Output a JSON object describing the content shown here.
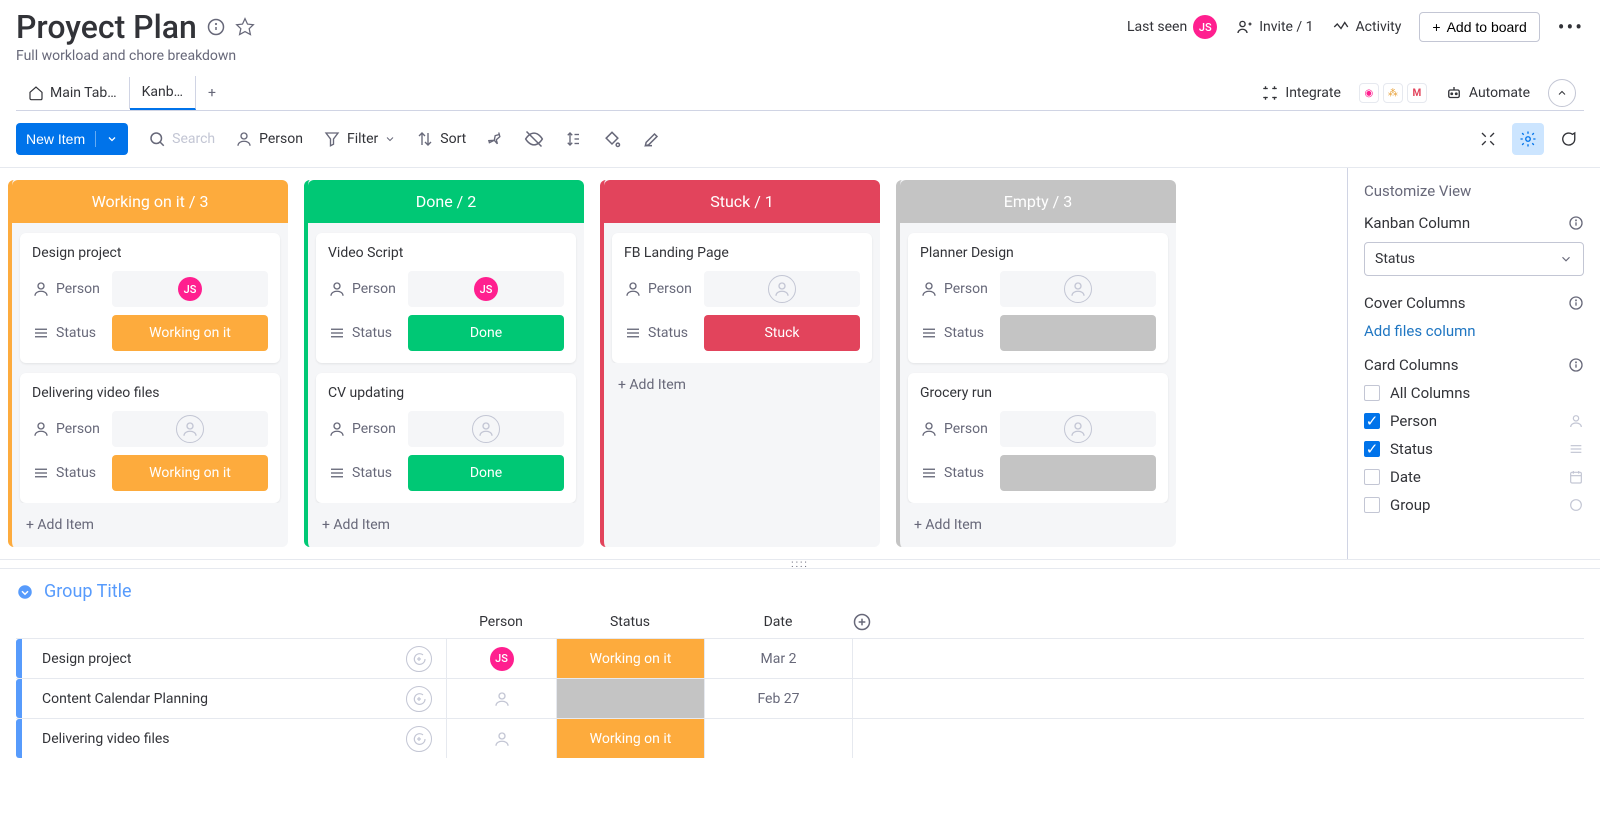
{
  "header": {
    "title": "Proyect Plan",
    "subtitle": "Full workload and chore breakdown",
    "last_seen": "Last seen",
    "avatar": "JS",
    "invite": "Invite / 1",
    "activity": "Activity",
    "add_to_board": "Add to board"
  },
  "tabs": {
    "main": "Main Tab…",
    "kanban": "Kanb…",
    "integrate": "Integrate",
    "automate": "Automate"
  },
  "toolbar": {
    "new_item": "New Item",
    "search": "Search",
    "person": "Person",
    "filter": "Filter",
    "sort": "Sort"
  },
  "columns": [
    {
      "title": "Working on it / 3",
      "color": "orange",
      "add": "+ Add Item",
      "cards": [
        {
          "title": "Design project",
          "person": "JS",
          "status": "Working on it",
          "statusColor": "orange"
        },
        {
          "title": "Delivering video files",
          "person": "",
          "status": "Working on it",
          "statusColor": "orange"
        }
      ]
    },
    {
      "title": "Done / 2",
      "color": "green",
      "add": "+ Add Item",
      "cards": [
        {
          "title": "Video Script",
          "person": "JS",
          "status": "Done",
          "statusColor": "green"
        },
        {
          "title": "CV updating",
          "person": "",
          "status": "Done",
          "statusColor": "green"
        }
      ]
    },
    {
      "title": "Stuck / 1",
      "color": "red",
      "add": "+ Add Item",
      "cards": [
        {
          "title": "FB Landing Page",
          "person": "",
          "status": "Stuck",
          "statusColor": "red"
        }
      ]
    },
    {
      "title": "Empty / 3",
      "color": "gray",
      "add": "+ Add Item",
      "cards": [
        {
          "title": "Planner Design",
          "person": "",
          "status": "",
          "statusColor": "empty-gray"
        },
        {
          "title": "Grocery run",
          "person": "",
          "status": "",
          "statusColor": "empty-gray"
        }
      ]
    }
  ],
  "card_labels": {
    "person": "Person",
    "status": "Status"
  },
  "side": {
    "customize": "Customize View",
    "kanban_col": "Kanban Column",
    "status": "Status",
    "cover": "Cover Columns",
    "add_files": "Add files column",
    "card_cols": "Card Columns",
    "checks": {
      "all": "All Columns",
      "person": "Person",
      "status": "Status",
      "date": "Date",
      "group": "Group"
    }
  },
  "group": {
    "title": "Group Title",
    "headers": {
      "person": "Person",
      "status": "Status",
      "date": "Date"
    },
    "rows": [
      {
        "name": "Design project",
        "person": "JS",
        "status": "Working on it",
        "statusColor": "orange",
        "date": "Mar 2"
      },
      {
        "name": "Content Calendar Planning",
        "person": "",
        "status": "",
        "statusColor": "",
        "date": "Feb 27"
      },
      {
        "name": "Delivering video files",
        "person": "",
        "status": "Working on it",
        "statusColor": "orange",
        "date": ""
      }
    ]
  }
}
